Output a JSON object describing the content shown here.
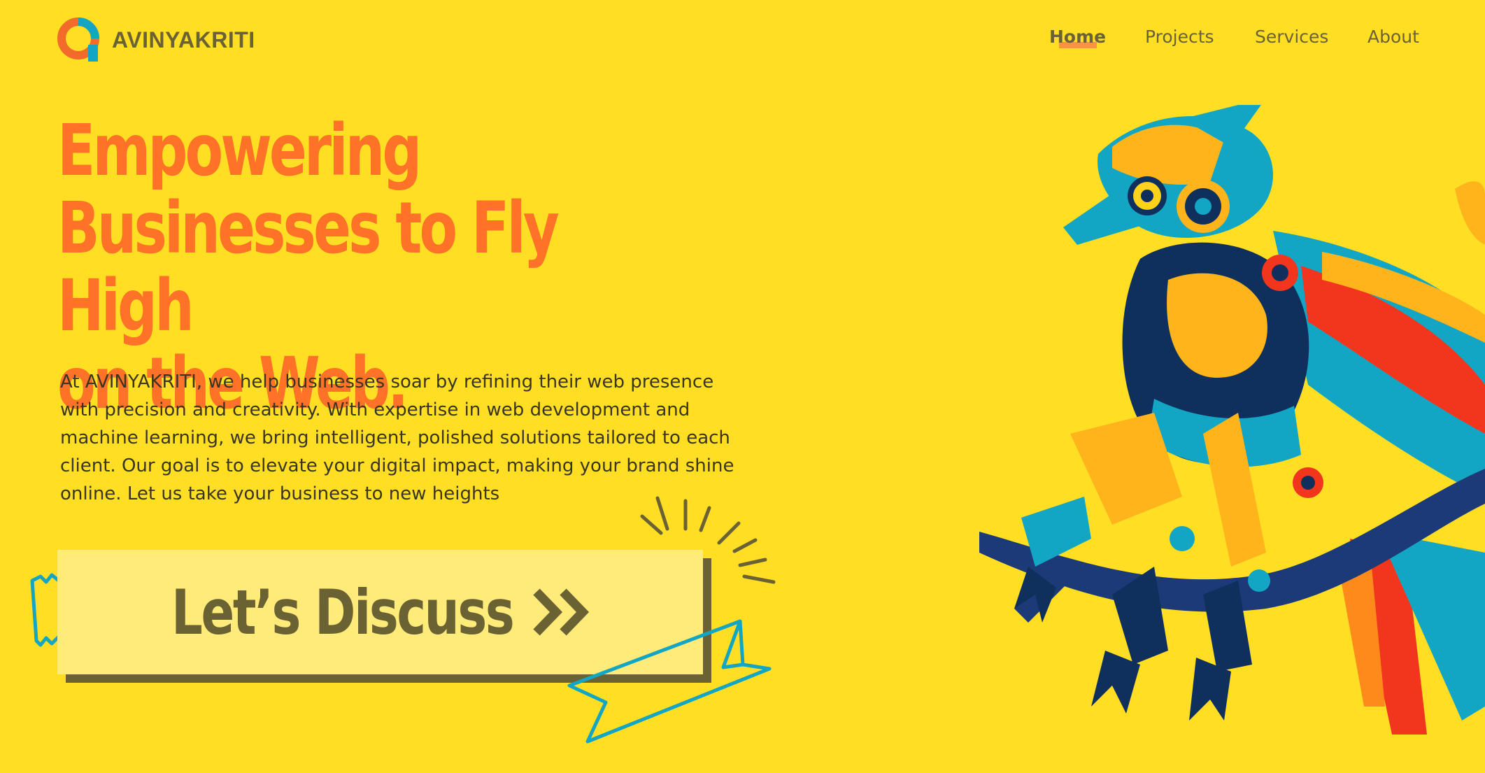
{
  "brand": {
    "name": "AVINYAKRITI",
    "logo_icon": "logo-ring-icon"
  },
  "nav": {
    "items": [
      {
        "label": "Home",
        "active": true
      },
      {
        "label": "Projects",
        "active": false
      },
      {
        "label": "Services",
        "active": false
      },
      {
        "label": "About",
        "active": false
      }
    ]
  },
  "hero": {
    "title": "Empowering\nBusinesses to Fly High\non the Web.",
    "description": "At AVINYAKRITI, we help businesses soar by refining their web presence with precision and creativity. With expertise in web development and machine learning, we bring intelligent, polished solutions tailored to each client. Our goal is to elevate your digital impact, making your brand shine online. Let us take your business to new heights",
    "cta_label": "Let’s Discuss",
    "cta_icon": "double-chevron-right-icon"
  },
  "illustration": {
    "subject": "robotic-bird-illustration"
  },
  "colors": {
    "background": "#FFDE24",
    "accent": "#FF7228",
    "text_dark": "#6B6233",
    "cta_fill": "#FFEB7A",
    "teal": "#12A6C4"
  }
}
